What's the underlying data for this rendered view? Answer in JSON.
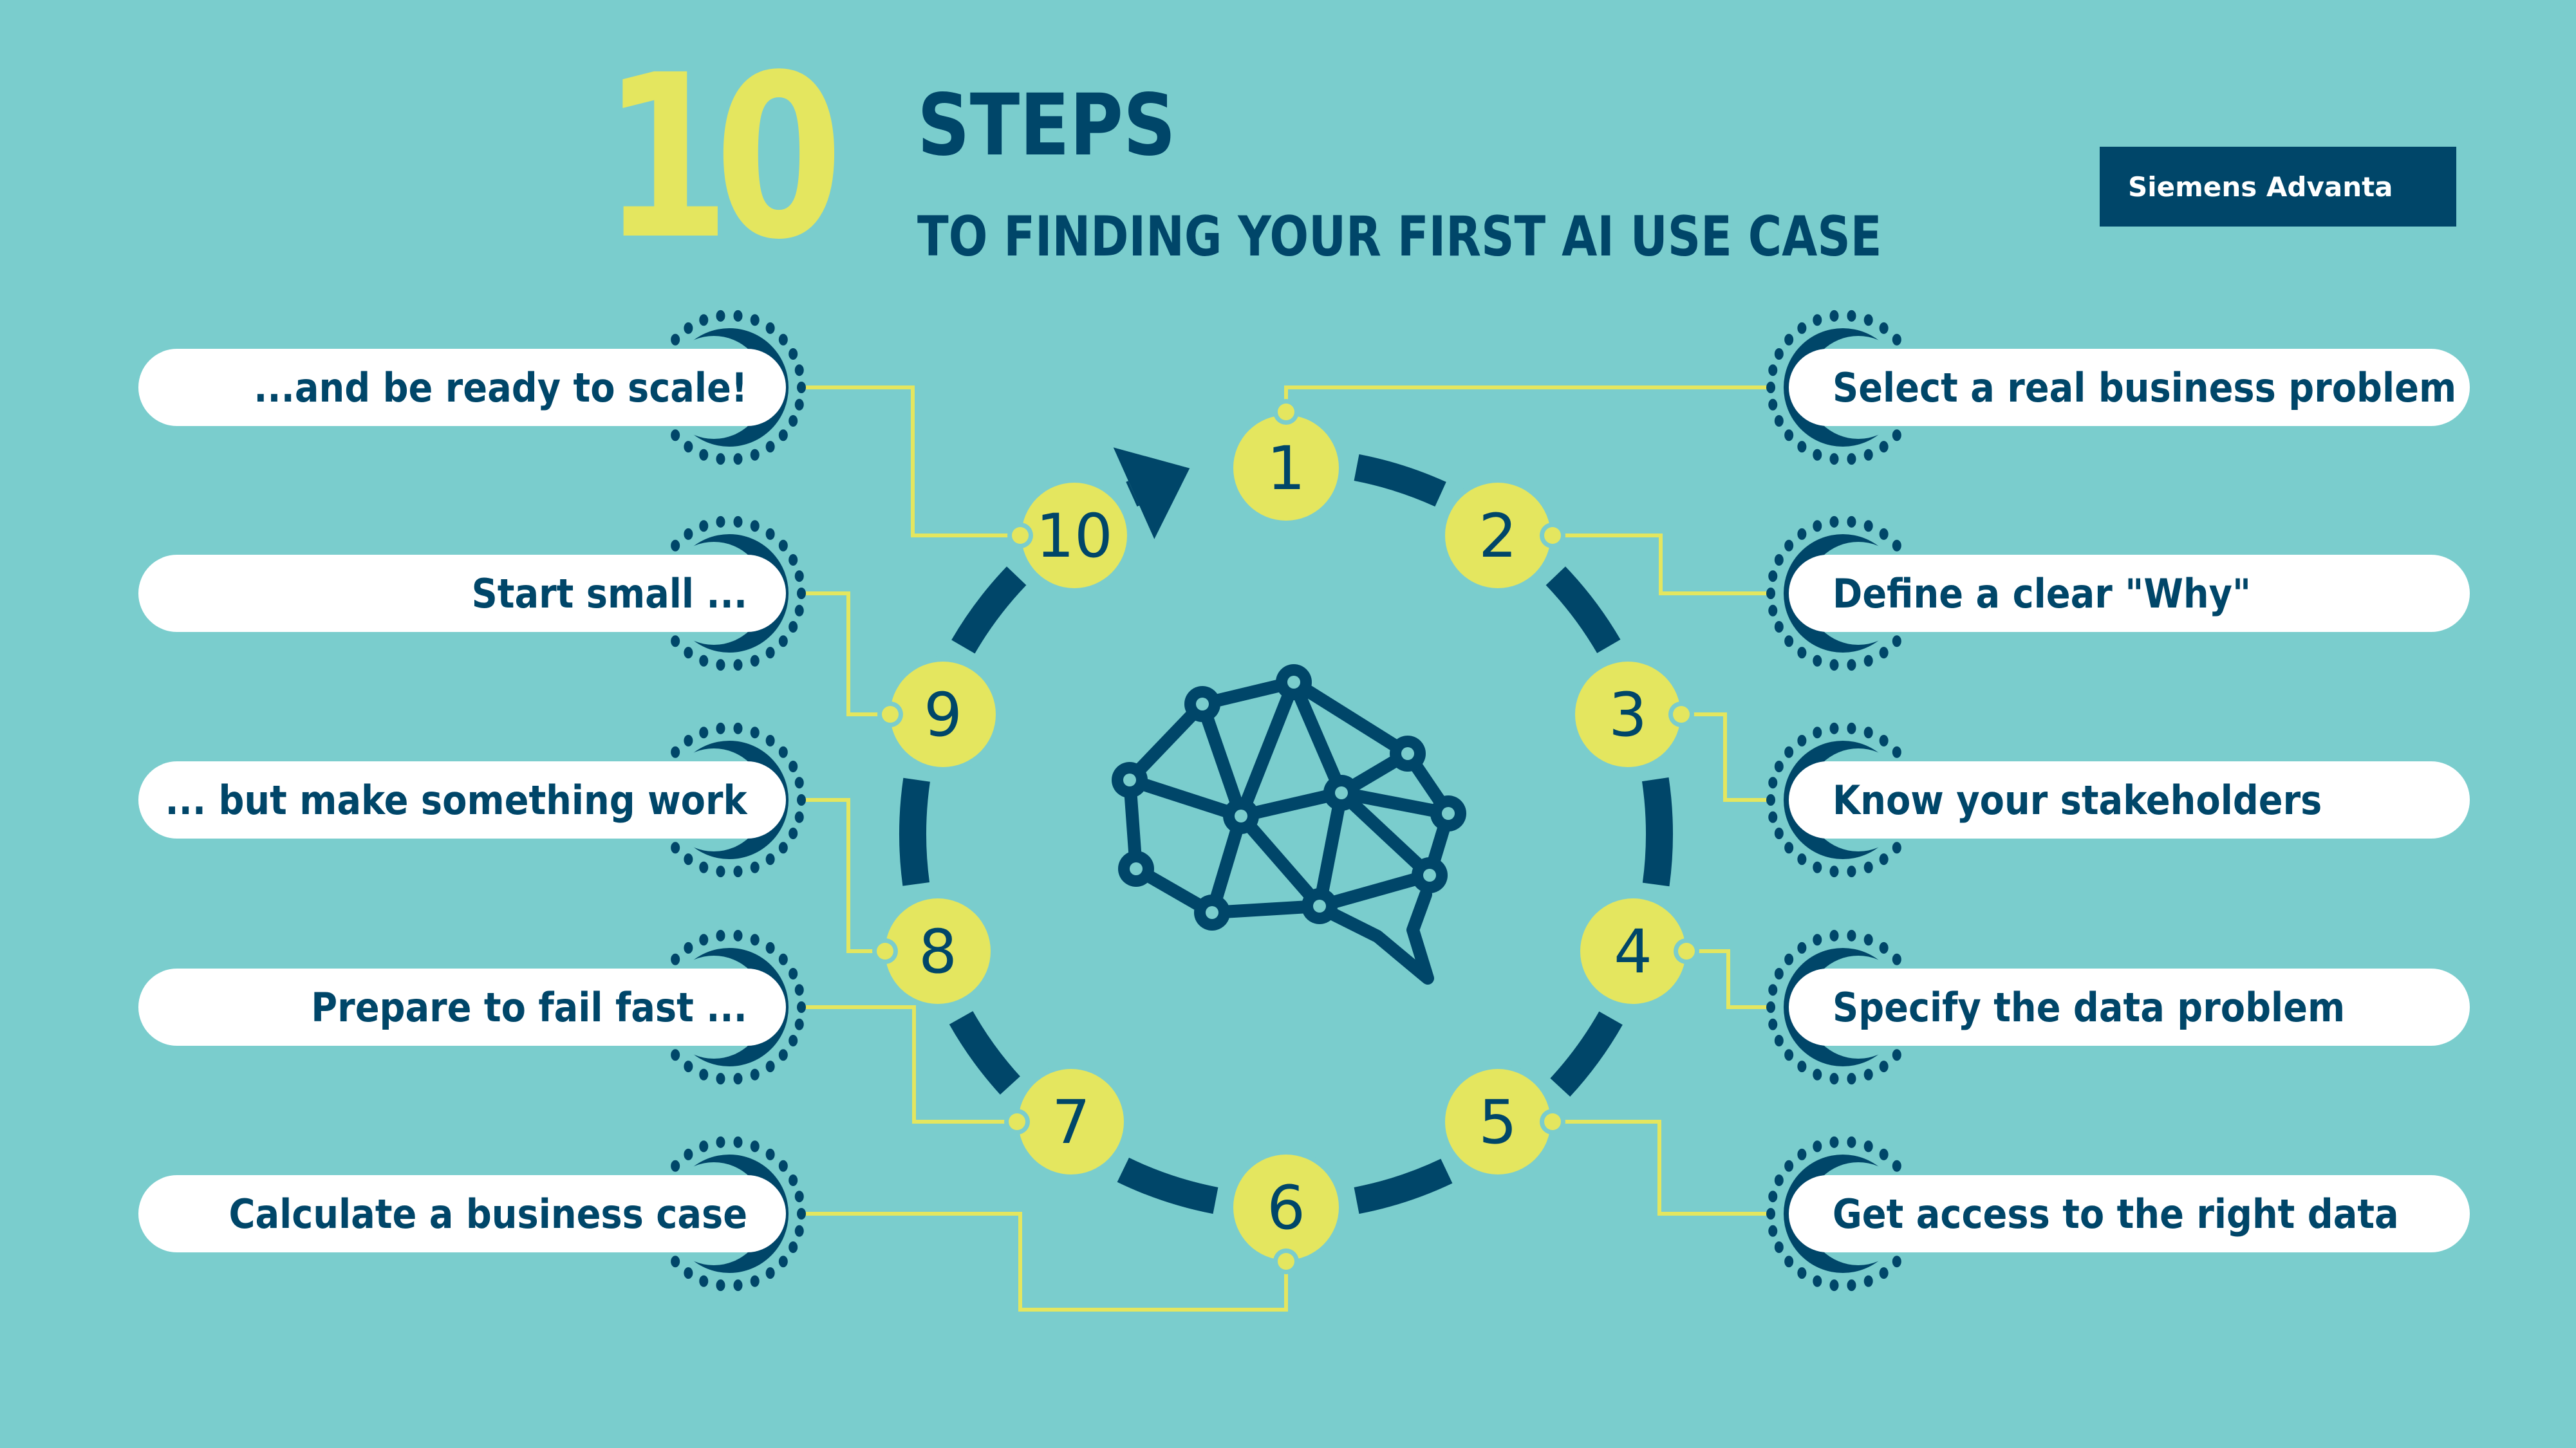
{
  "header": {
    "big_number": "10",
    "title": "STEPS",
    "subtitle": "TO FINDING YOUR FIRST AI USE CASE"
  },
  "brand": {
    "label": "Siemens Advanta"
  },
  "colors": {
    "background": "#7acdcd",
    "navy": "#004669",
    "yellow": "#e4e65f",
    "white": "#ffffff"
  },
  "center_icon": "brain-network-speech-bubble-icon",
  "cycle_arrow_icon": "arrow-right-icon",
  "steps": [
    {
      "number": "1",
      "label": "Select a real business problem",
      "side": "right"
    },
    {
      "number": "2",
      "label": "Define a clear \"Why\"",
      "side": "right"
    },
    {
      "number": "3",
      "label": "Know your stakeholders",
      "side": "right"
    },
    {
      "number": "4",
      "label": "Specify the data problem",
      "side": "right"
    },
    {
      "number": "5",
      "label": "Get access to the right data",
      "side": "right"
    },
    {
      "number": "6",
      "label": "Calculate a business case",
      "side": "left"
    },
    {
      "number": "7",
      "label": "Prepare to fail fast ...",
      "side": "left"
    },
    {
      "number": "8",
      "label": "... but make something work",
      "side": "left"
    },
    {
      "number": "9",
      "label": "Start small ...",
      "side": "left"
    },
    {
      "number": "10",
      "label": "...and be ready to scale!",
      "side": "left"
    }
  ]
}
